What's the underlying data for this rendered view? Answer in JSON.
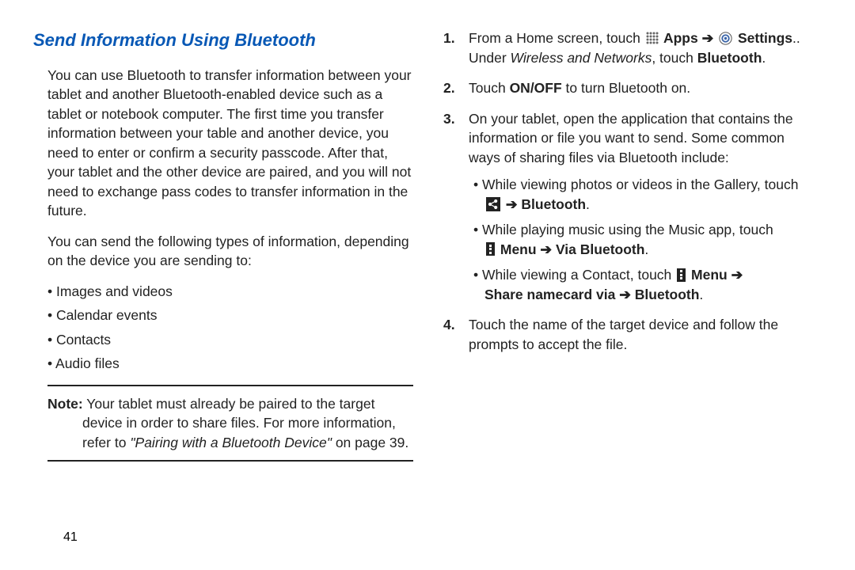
{
  "heading": "Send Information Using Bluetooth",
  "left": {
    "p1": "You can use Bluetooth to transfer information between your tablet and another Bluetooth-enabled device such as a tablet or notebook computer. The first time you transfer information between your table and another device, you need to enter or confirm a security passcode. After that, your tablet and the other device are paired, and you will not need to exchange pass codes to transfer information in the future.",
    "p2": "You can send the following types of information, depending on the device you are sending to:",
    "bullets": [
      "Images and videos",
      "Calendar events",
      "Contacts",
      "Audio files"
    ],
    "note_prefix": "Note:",
    "note_body": " Your tablet must already be paired to the target device in order to share files. For more information, refer to ",
    "note_ref": "\"Pairing with a Bluetooth Device\"",
    "note_tail": " on page 39."
  },
  "right": {
    "step1_a": "From a Home screen, touch ",
    "apps_label": " Apps",
    "arrow": " ➔ ",
    "settings_label": " Settings",
    "step1_b": ". Under ",
    "wireless": "Wireless and Networks",
    "step1_c": ", touch ",
    "bluetooth": "Bluetooth",
    "period": ".",
    "step2_a": "Touch ",
    "onoff": "ON/OFF",
    "step2_b": " to turn Bluetooth on.",
    "step3": "On your tablet, open the application that contains the information or file you want to send. Some common ways of sharing files via Bluetooth include:",
    "sub_gallery": "While viewing photos or videos in the Gallery, touch ",
    "sub_music": "While playing music using the Music app, touch ",
    "menu_label": " Menu",
    "via_bt": "Via Bluetooth",
    "sub_contact_a": "While viewing a Contact, touch ",
    "share_namecard": "Share namecard via",
    "step4": "Touch the name of the target device and follow the prompts to accept the file."
  },
  "page_number": "41"
}
